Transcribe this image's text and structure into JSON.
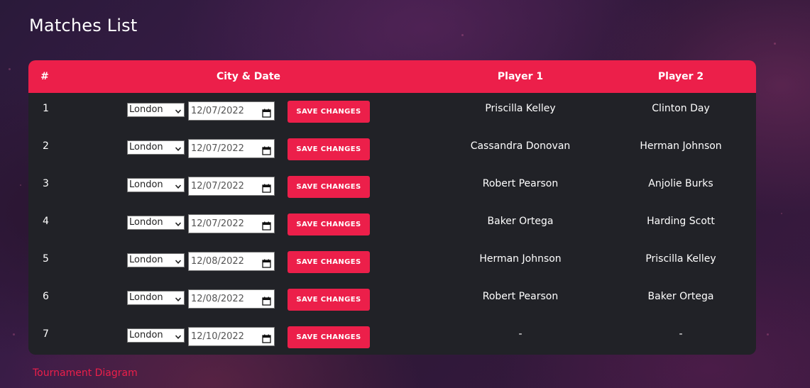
{
  "page": {
    "title": "Matches List",
    "footer_link": "Tournament Diagram"
  },
  "colors": {
    "accent": "#ec1f4a",
    "table_bg": "#212227"
  },
  "table": {
    "headers": [
      "#",
      "City & Date",
      "Player 1",
      "Player 2"
    ],
    "save_label": "SAVE CHANGES",
    "rows": [
      {
        "num": "1",
        "city": "London",
        "date": "12/07/2022",
        "player1": "Priscilla Kelley",
        "player2": "Clinton Day"
      },
      {
        "num": "2",
        "city": "London",
        "date": "12/07/2022",
        "player1": "Cassandra Donovan",
        "player2": "Herman Johnson"
      },
      {
        "num": "3",
        "city": "London",
        "date": "12/07/2022",
        "player1": "Robert Pearson",
        "player2": "Anjolie Burks"
      },
      {
        "num": "4",
        "city": "London",
        "date": "12/07/2022",
        "player1": "Baker Ortega",
        "player2": "Harding Scott"
      },
      {
        "num": "5",
        "city": "London",
        "date": "12/08/2022",
        "player1": "Herman Johnson",
        "player2": "Priscilla Kelley"
      },
      {
        "num": "6",
        "city": "London",
        "date": "12/08/2022",
        "player1": "Robert Pearson",
        "player2": "Baker Ortega"
      },
      {
        "num": "7",
        "city": "London",
        "date": "12/10/2022",
        "player1": "-",
        "player2": "-"
      }
    ]
  }
}
